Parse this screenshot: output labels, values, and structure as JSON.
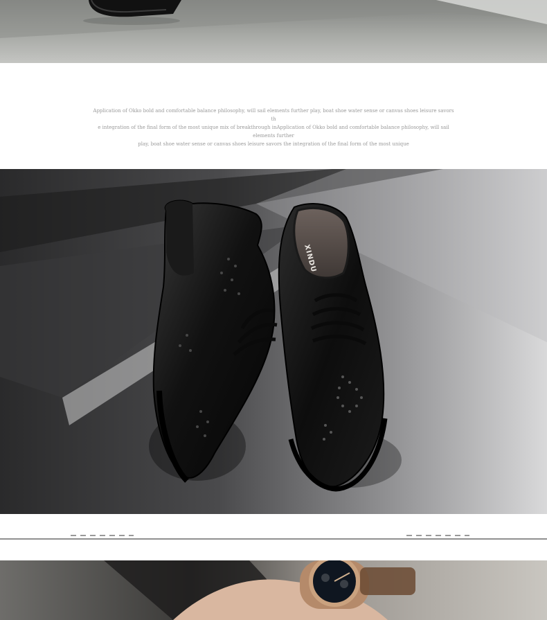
{
  "description": {
    "lines": [
      "Application of Okko bold and comfortable balance philosophy, will sail elements further play, boat shoe water sense or canvas shoes leisure savors th",
      "e integration of the final form of the most unique mix of breakthrough inApplication of Okko bold and comfortable balance philosophy, will sail elements further",
      "play, boat shoe water sense or canvas shoes leisure savors the integration of the final form of the most unique"
    ]
  },
  "shoe_photo": {
    "insole_brand": "XINDU"
  },
  "colors": {
    "page_bg": "#ffffff",
    "text_muted": "#9a9a9a",
    "divider": "#222222"
  }
}
